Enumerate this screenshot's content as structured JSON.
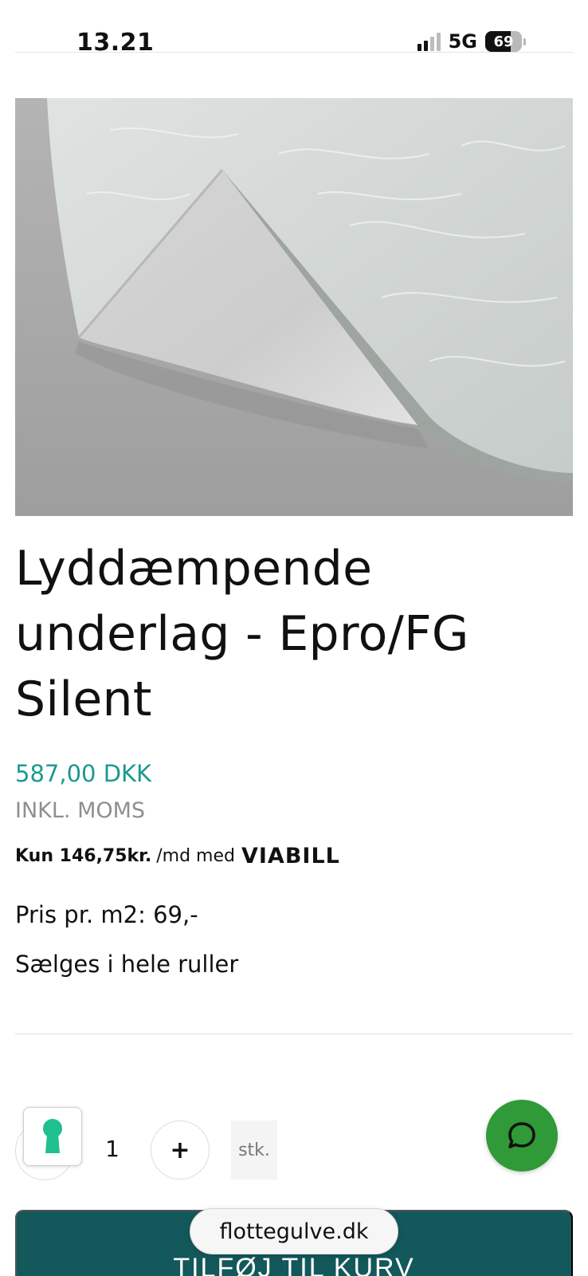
{
  "status_bar": {
    "time": "13.21",
    "network": "5G",
    "battery": "69",
    "battery_level": 0.69
  },
  "product": {
    "image_alt": "Lyddæmpende underlag",
    "title": "Lyddæmpende underlag - Epro/FG Silent",
    "price": "587,00 DKK",
    "vat_note": "INKL. MOMS",
    "installment_strong": "Kun 146,75kr.",
    "installment_rest": "/md med",
    "installment_provider": "VIABILL",
    "price_per_m2": "Pris pr. m2: 69,-",
    "sold_as": "Sælges i hele ruller"
  },
  "quantity": {
    "value": "1",
    "plus_label": "+",
    "unit": "stk."
  },
  "cart": {
    "add_label": "TILFØJ TIL KURV"
  },
  "browser": {
    "url": "flottegulve.dk"
  },
  "colors": {
    "price": "#1a9a8f",
    "cart_button": "#13585b",
    "chat_button": "#2f9a37",
    "badge_icon": "#1fbf8f"
  },
  "icons": {
    "chat": "chat-bubble-icon",
    "badge": "keyhole-icon",
    "signal": "signal-icon",
    "battery": "battery-icon"
  }
}
